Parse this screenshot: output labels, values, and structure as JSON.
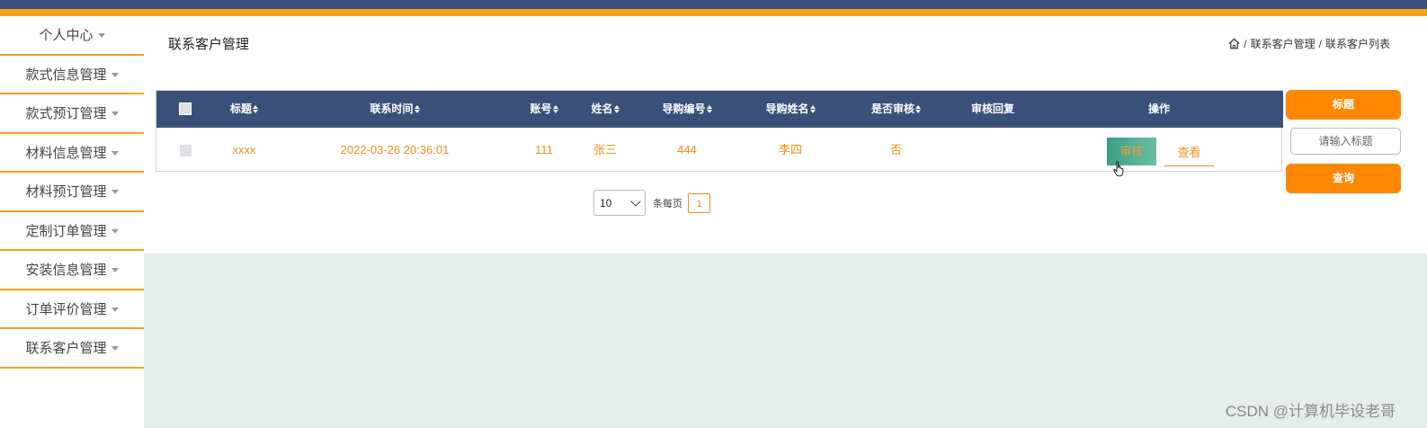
{
  "sidebar": {
    "items": [
      {
        "label": "个人中心"
      },
      {
        "label": "款式信息管理"
      },
      {
        "label": "款式预订管理"
      },
      {
        "label": "材料信息管理"
      },
      {
        "label": "材料预订管理"
      },
      {
        "label": "定制订单管理"
      },
      {
        "label": "安装信息管理"
      },
      {
        "label": "订单评价管理"
      },
      {
        "label": "联系客户管理"
      }
    ]
  },
  "header": {
    "title": "联系客户管理",
    "breadcrumb": [
      "联系客户管理",
      "联系客户列表"
    ],
    "separator": "/"
  },
  "table": {
    "columns": [
      "标题",
      "联系时间",
      "账号",
      "姓名",
      "导购编号",
      "导购姓名",
      "是否审核",
      "审核回复",
      "操作"
    ],
    "rows": [
      {
        "title": "xxxx",
        "contact_time": "2022-03-26 20:36:01",
        "account": "111",
        "name": "张三",
        "guide_id": "444",
        "guide_name": "李四",
        "audited": "否",
        "reply": ""
      }
    ],
    "actions": {
      "audit": "审核",
      "view": "查看"
    }
  },
  "pagination": {
    "page_size": "10",
    "per_page_label": "条每页",
    "current_page": "1"
  },
  "search": {
    "field_button": "标题",
    "placeholder": "请输入标题",
    "query_button": "查询"
  },
  "watermark": "CSDN @计算机毕设老哥",
  "colors": {
    "navy": "#3b5079",
    "orange": "#f7a21b",
    "accent": "#ff8800",
    "text_orange": "#f08c1a",
    "bg_mint": "#e3efeb"
  },
  "icons": [
    "home-icon",
    "caret-down-icon",
    "sort-icon",
    "chevron-down-icon",
    "hand-cursor-icon"
  ]
}
